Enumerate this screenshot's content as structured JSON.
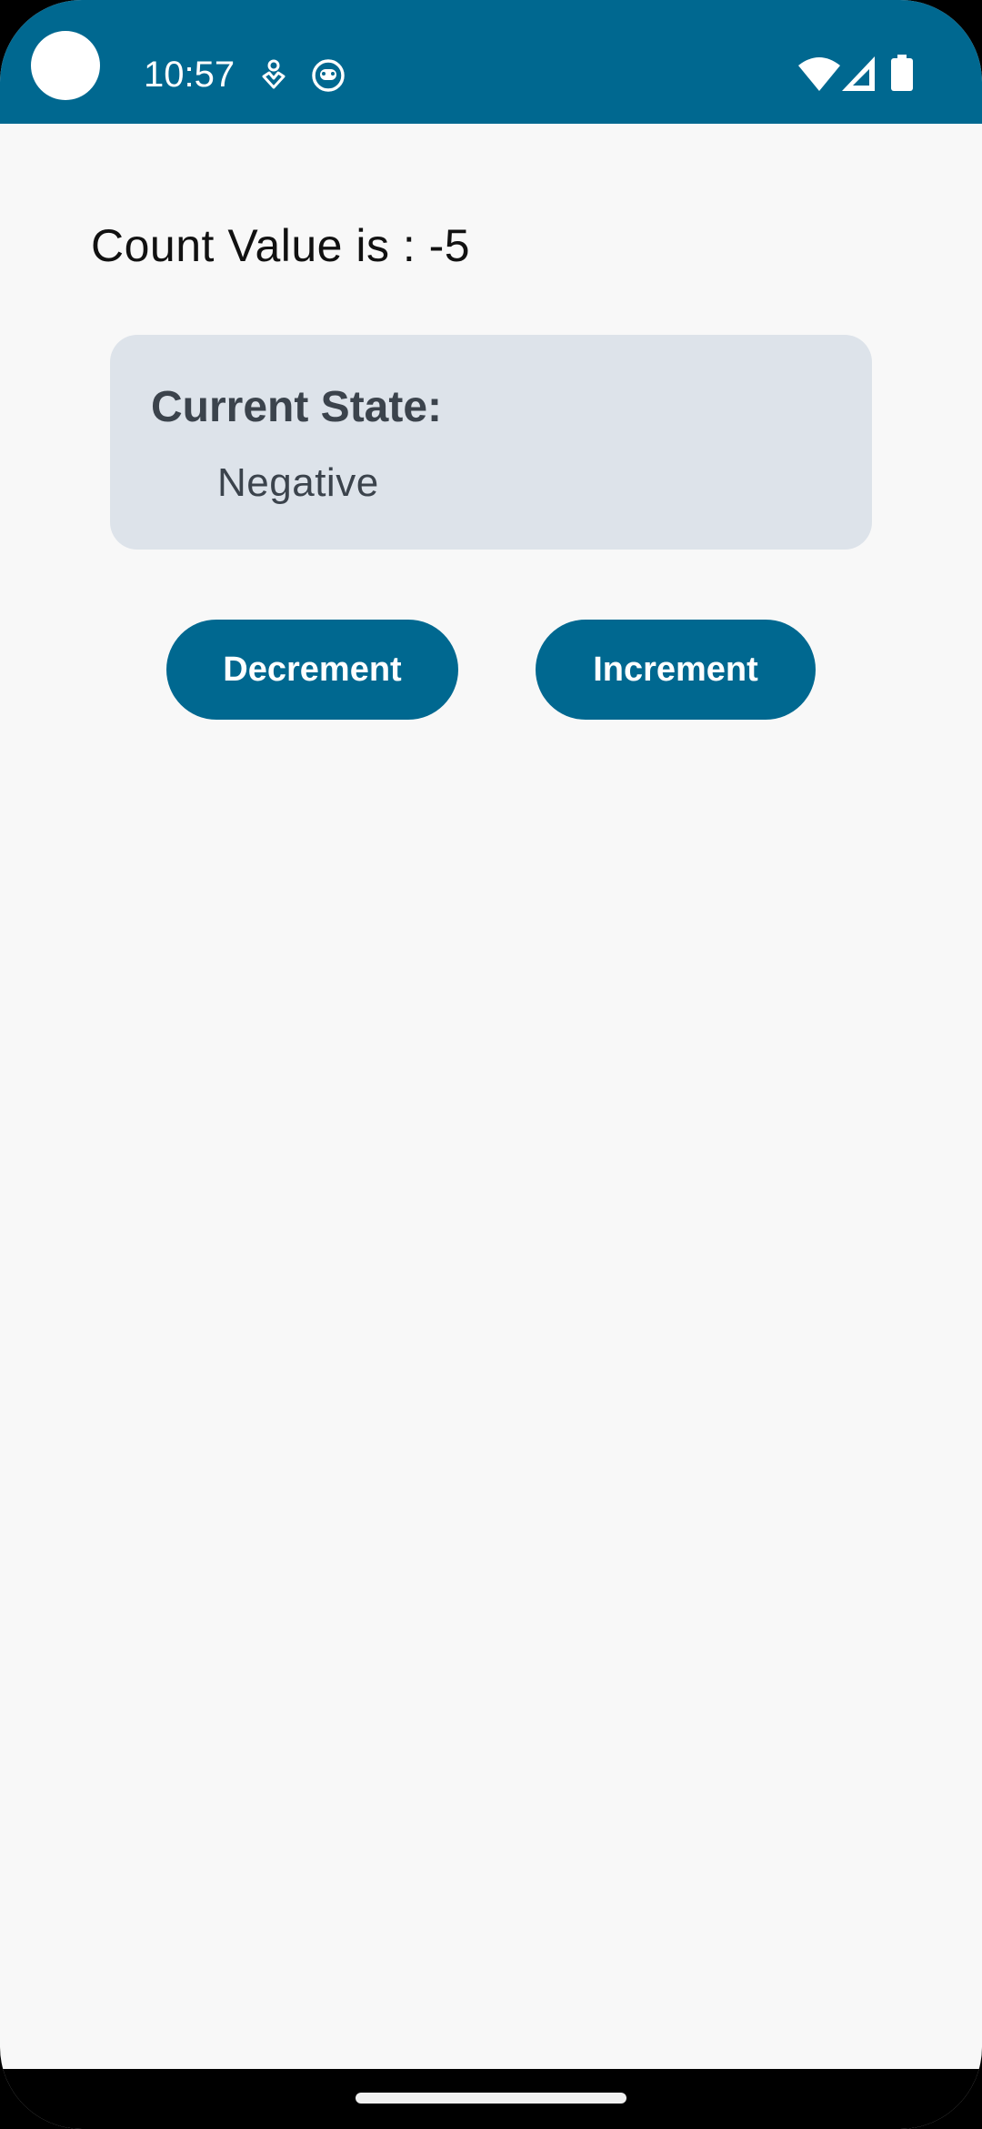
{
  "status_bar": {
    "time": "10:57",
    "background_color": "#006890",
    "icons": [
      "camera-cutout",
      "notification-icon",
      "notification-icon",
      "wifi-icon",
      "cellular-signal-icon",
      "battery-icon"
    ]
  },
  "main": {
    "count_text": "Count Value is : -5",
    "state_card": {
      "title": "Current State:",
      "value": "Negative"
    },
    "buttons": {
      "decrement_label": "Decrement",
      "increment_label": "Increment"
    },
    "accent_color": "#006890",
    "card_color": "#dde3ea"
  }
}
